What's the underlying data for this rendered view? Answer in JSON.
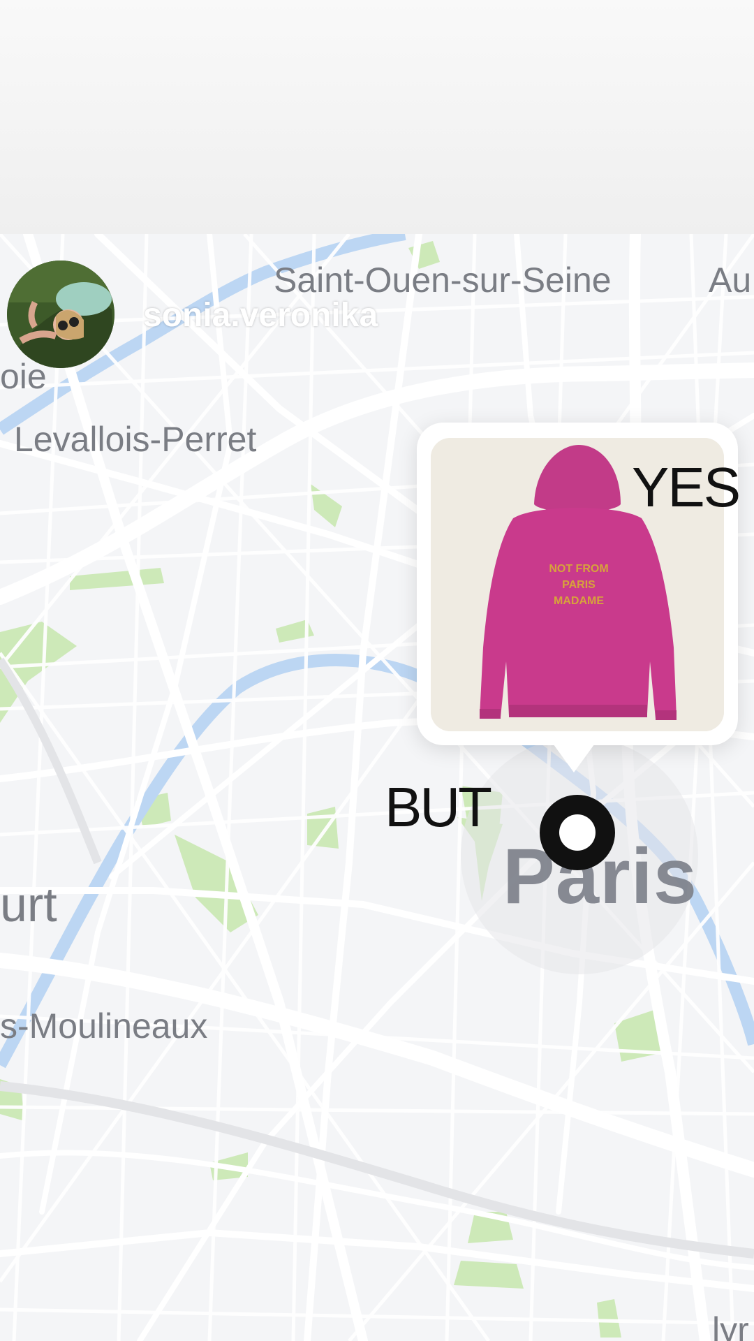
{
  "user": {
    "username": "sonia.veronika"
  },
  "map": {
    "places": {
      "saint_ouen": "Saint-Ouen-sur-Seine",
      "au": "Au",
      "oie": "oie",
      "levallois": "Levallois-Perret",
      "paris": "Paris",
      "urt": "urt",
      "moulineaux": "s-Moulineaux",
      "lyr": "lyr"
    }
  },
  "stickers": {
    "yes": "YES",
    "but": "BUT"
  },
  "product": {
    "print_line1": "NOT FROM",
    "print_line2": "PARIS",
    "print_line3": "MADAME"
  },
  "colors": {
    "hoodie": "#c93a8c",
    "river": "#b9d4f2",
    "park": "#c9e7b4"
  }
}
